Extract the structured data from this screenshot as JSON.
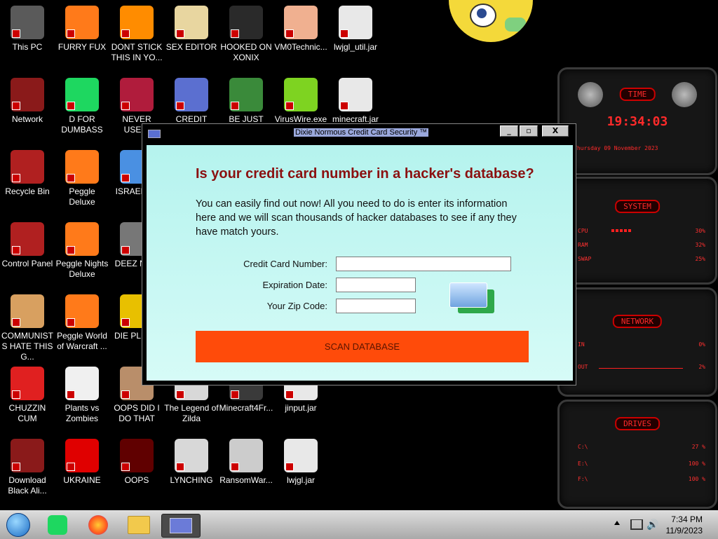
{
  "desktop": {
    "icons": [
      {
        "label": "This PC"
      },
      {
        "label": "FURRY FUX"
      },
      {
        "label": "DONT STICK THIS IN YO..."
      },
      {
        "label": "SEX EDITOR"
      },
      {
        "label": "HOOKED ON XONIX"
      },
      {
        "label": "VM0Technic..."
      },
      {
        "label": "lwjgl_util.jar"
      },
      {
        "label": "Network"
      },
      {
        "label": "D FOR DUMBASS"
      },
      {
        "label": "NEVER USED!"
      },
      {
        "label": "CREDIT CARD CHECKER"
      },
      {
        "label": "BE JUST LIKE THE DUDE!"
      },
      {
        "label": "VirusWire.exe"
      },
      {
        "label": "minecraft.jar"
      },
      {
        "label": "Recycle Bin"
      },
      {
        "label": "Peggle Deluxe"
      },
      {
        "label": "ISRAELS..."
      },
      {
        "label": "Control Panel"
      },
      {
        "label": "Peggle Nights Deluxe"
      },
      {
        "label": "DEEZ NU..."
      },
      {
        "label": "COMMUNISTS HATE THIS G..."
      },
      {
        "label": "Peggle World of Warcraft ..."
      },
      {
        "label": "DIE PLEA..."
      },
      {
        "label": "CHUZZIN CUM"
      },
      {
        "label": "Plants vs Zombies"
      },
      {
        "label": "OOPS DID I DO THAT"
      },
      {
        "label": "The Legend of Zilda"
      },
      {
        "label": "Minecraft4Fr..."
      },
      {
        "label": "jinput.jar"
      },
      {
        "label": "Download Black Ali..."
      },
      {
        "label": "UKRAINE"
      },
      {
        "label": "OOPS"
      },
      {
        "label": "LYNCHING"
      },
      {
        "label": "RansomWar..."
      },
      {
        "label": "lwjgl.jar"
      }
    ]
  },
  "widget": {
    "time_title": "TIME",
    "time": "19:34:03",
    "date": "Thursday 09 November 2023",
    "system_title": "SYSTEM",
    "cpu_label": "CPU",
    "cpu_val": "30%",
    "ram_label": "RAM",
    "ram_val": "32%",
    "swap_label": "SWAP",
    "swap_val": "25%",
    "network_title": "NETWORK",
    "in_label": "IN",
    "in_val": "0%",
    "out_label": "OUT",
    "out_val": "2%",
    "drives_title": "DRIVES",
    "drive_c": "C:\\",
    "drive_c_val": "27 %",
    "drive_e": "E:\\",
    "drive_e_val": "100 %",
    "drive_f": "F:\\",
    "drive_f_val": "100 %"
  },
  "dialog": {
    "title": "Dixie Normous Credit Card Security ™",
    "minimize": "_",
    "maximize": "▫",
    "close": "X",
    "heading": "Is your credit card number in a hacker's database?",
    "paragraph": "You can easily find out now! All you need to do is enter its information here and we will scan thousands of hacker databases to see if any they have match yours.",
    "cc_label": "Credit Card Number:",
    "exp_label": "Expiration Date:",
    "zip_label": "Your Zip Code:",
    "cc_value": "",
    "exp_value": "",
    "zip_value": "",
    "scan_button": "SCAN DATABASE"
  },
  "taskbar": {
    "time": "7:34 PM",
    "date": "11/9/2023",
    "icons": [
      "start-orb-icon",
      "spotify-icon",
      "firefox-icon",
      "file-explorer-icon",
      "credit-card-checker-icon"
    ]
  }
}
